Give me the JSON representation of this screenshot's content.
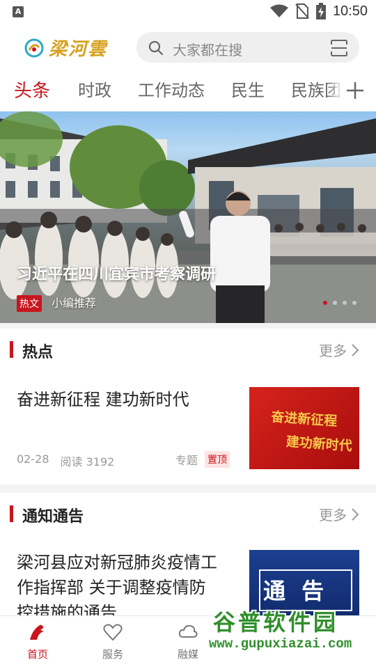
{
  "status_bar": {
    "time": "10:50",
    "notification_letter": "A"
  },
  "header": {
    "app_name": "梁河雲",
    "search_placeholder": "大家都在搜"
  },
  "tabs": [
    {
      "label": "头条",
      "active": true
    },
    {
      "label": "时政"
    },
    {
      "label": "工作动态"
    },
    {
      "label": "民生"
    },
    {
      "label": "民族团"
    }
  ],
  "carousel": {
    "caption": "习近平在四川宜宾市考察调研",
    "tag": "热文",
    "subtitle": "小编推荐",
    "slide_index": 1,
    "slide_count": 4
  },
  "hot": {
    "title": "热点",
    "more": "更多",
    "item": {
      "title": "奋进新征程 建功新时代",
      "date": "02-28",
      "reads": "阅读 3192",
      "type": "专题",
      "pin": "置顶",
      "thumb_text": [
        "奋进新征程",
        "建功新时代"
      ]
    }
  },
  "notice": {
    "title": "通知通告",
    "more": "更多",
    "item": {
      "title_lines": [
        "梁河县应对新冠肺炎疫情工",
        "作指挥部 关于调整疫情防",
        "控措施的通告"
      ],
      "thumb_text": "通 告"
    }
  },
  "bottom_nav": [
    {
      "label": "首页",
      "active": true
    },
    {
      "label": "服务"
    },
    {
      "label": "融媒"
    }
  ],
  "watermark": {
    "name": "谷普软件园",
    "url": "www.gupuxiazai.com"
  },
  "colors": {
    "accent": "#c8161e",
    "logo_gold": "#d7a01b"
  }
}
